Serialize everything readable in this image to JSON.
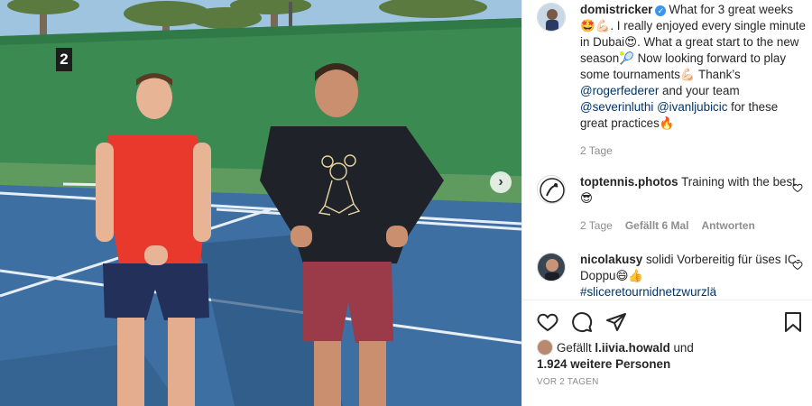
{
  "photo": {
    "court_number": "2",
    "next_icon": "chevron-right-icon"
  },
  "caption": {
    "username": "domistricker",
    "verified_icon": "verified-badge-icon",
    "text_1": "What for 3 great weeks 🤩💪🏻. I really enjoyed every single minute in Dubai😍. What a great start to the new season🎾 Now looking forward to play some tournaments💪🏻 Thank’s ",
    "mention_1": "@rogerfederer",
    "text_2": " and your team ",
    "mention_2": "@severinluthi",
    "mention_3": "@ivanljubicic",
    "text_3": " for these great practices🔥",
    "time": "2 Tage"
  },
  "comments": [
    {
      "username": "toptennis.photos",
      "text": "Training with the best 😎",
      "time": "2 Tage",
      "likes": "Gefällt 6 Mal",
      "reply": "Antworten"
    },
    {
      "username": "nicolakusy",
      "text": "solidi Vorbereitig für üses IC-Doppu😄👍",
      "hashtag": "#sliceretournidnetzwurzlä"
    }
  ],
  "actions": {
    "like_icon": "heart-icon",
    "comment_icon": "comment-icon",
    "share_icon": "share-icon",
    "save_icon": "bookmark-icon"
  },
  "likes": {
    "prefix": "Gefällt ",
    "user": "l.iivia.howald",
    "middle": " und",
    "count": "1.924 weitere Personen"
  },
  "posted": "VOR 2 TAGEN"
}
